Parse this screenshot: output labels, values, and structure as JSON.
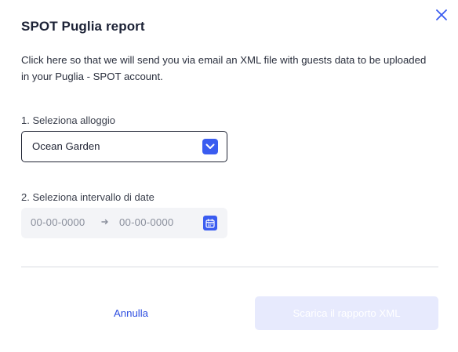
{
  "dialog": {
    "title": "SPOT Puglia report",
    "description": "Click here so that we will send you via email an XML file with guests data to be uploaded in your Puglia - SPOT account.",
    "close_icon": "close-icon"
  },
  "accommodation": {
    "label": "1. Seleziona alloggio",
    "selected_value": "Ocean Garden",
    "chevron_icon": "chevron-down-icon"
  },
  "date_range": {
    "label": "2. Seleziona intervallo di date",
    "start_placeholder": "00-00-0000",
    "end_placeholder": "00-00-0000",
    "arrow_icon": "arrow-right-icon",
    "calendar_icon": "calendar-icon"
  },
  "actions": {
    "cancel_label": "Annulla",
    "download_label": "Scarica il rapporto XML",
    "download_disabled": true
  },
  "colors": {
    "accent": "#3a5cf0",
    "link": "#2f4fe0",
    "disabled_button_bg": "#e7eafd",
    "title": "#1c2236"
  }
}
